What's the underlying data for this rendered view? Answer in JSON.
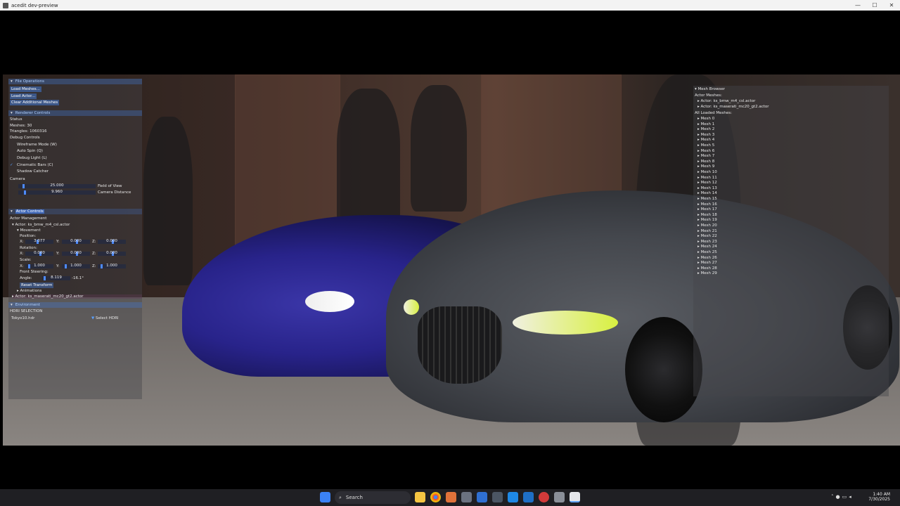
{
  "window": {
    "title": "acedit dev-preview",
    "buttons": [
      "—",
      "☐",
      "✕"
    ]
  },
  "left_panel": {
    "file_ops": {
      "header": "File Operations",
      "buttons": [
        "Load Meshes...",
        "Load Actor...",
        "Clear Additional Meshes"
      ]
    },
    "renderer": {
      "header": "Renderer Controls",
      "status_label": "Status",
      "meshes": "Meshes: 30",
      "triangles": "Triangles: 1060316",
      "debug_label": "Debug Controls",
      "toggles": [
        {
          "label": "Wireframe Mode (W)",
          "checked": false
        },
        {
          "label": "Auto Spin (Q)",
          "checked": false
        },
        {
          "label": "Debug Light (L)",
          "checked": false
        },
        {
          "label": "Cinematic Bars (C)",
          "checked": true
        },
        {
          "label": "Shadow Catcher",
          "checked": false
        }
      ],
      "camera_label": "Camera",
      "fov_value": "25.000",
      "fov_label": "Field of View",
      "dist_value": "9.960",
      "dist_label": "Camera Distance"
    },
    "actor": {
      "header": "Actor Controls",
      "management_label": "Actor Management",
      "actor1": "Actor: ks_bmw_m4_csl.actor",
      "movement": "Movement",
      "position_label": "Position:",
      "pos": {
        "x": "3.077",
        "y": "0.000",
        "z": "0.000"
      },
      "rotation_label": "Rotation:",
      "rot": {
        "x": "0.000",
        "y": "0.000",
        "z": "0.000"
      },
      "scale_label": "Scale:",
      "scale": {
        "x": "1.000",
        "y": "1.000",
        "z": "1.000"
      },
      "steering_label": "Front Steering:",
      "angle_label": "Angle:",
      "angle_value": "8.119",
      "angle_deg": "-16.1°",
      "axis_x": "X:",
      "axis_y": "Y:",
      "axis_z": "Z:",
      "reset_button": "Reset Transform",
      "animations": "Animations",
      "actor2": "Actor: ks_maserati_mc20_gt2.actor"
    },
    "environment": {
      "header": "Environment",
      "hdri_label": "HDRI SELECTION",
      "hdri_file": "Tokyo10.hdr",
      "select_button": "Select HDRI"
    }
  },
  "mesh_browser": {
    "header": "Mesh Browser",
    "actor_meshes_label": "Actor Meshes:",
    "actors": [
      "Actor: ks_bmw_m4_csl.actor",
      "Actor: ks_maserati_mc20_gt2.actor"
    ],
    "all_label": "All Loaded Meshes:",
    "meshes": [
      "Mesh 0",
      "Mesh 1",
      "Mesh 2",
      "Mesh 3",
      "Mesh 4",
      "Mesh 5",
      "Mesh 6",
      "Mesh 7",
      "Mesh 8",
      "Mesh 9",
      "Mesh 10",
      "Mesh 11",
      "Mesh 12",
      "Mesh 13",
      "Mesh 14",
      "Mesh 15",
      "Mesh 16",
      "Mesh 17",
      "Mesh 18",
      "Mesh 19",
      "Mesh 20",
      "Mesh 21",
      "Mesh 22",
      "Mesh 23",
      "Mesh 24",
      "Mesh 25",
      "Mesh 26",
      "Mesh 27",
      "Mesh 28",
      "Mesh 29"
    ]
  },
  "taskbar": {
    "search_placeholder": "Search",
    "time": "1:40 AM",
    "date": "7/30/2025"
  },
  "colors": {
    "accent": "#4d8aff",
    "header_text": "#aecfff",
    "taskbar": "#1f1f23"
  },
  "slider_levels": {
    "fov": 0.05,
    "camera_distance": 0.07,
    "angle": 0.52
  }
}
